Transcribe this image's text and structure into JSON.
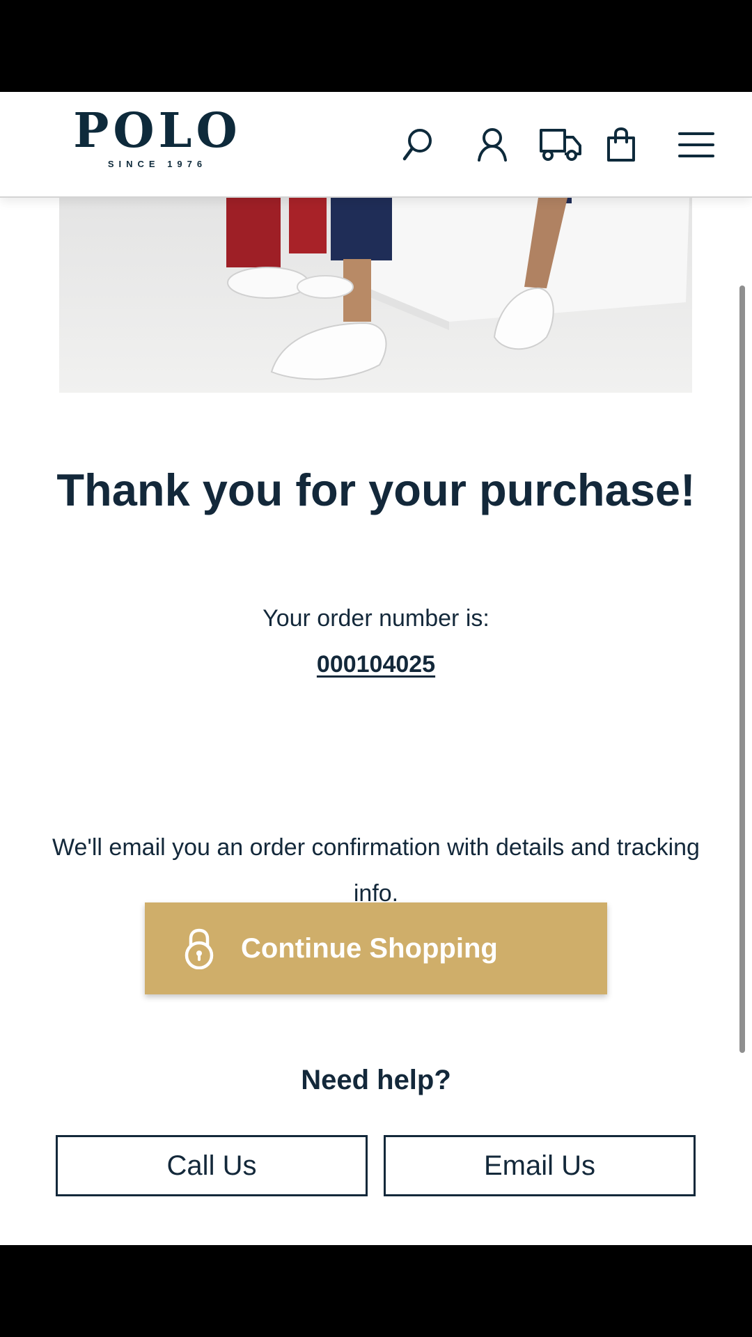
{
  "header": {
    "logo_name": "POLO",
    "logo_tagline": "SINCE 1976",
    "icons": [
      "search-icon",
      "account-icon",
      "delivery-truck-icon",
      "shopping-bag-icon",
      "menu-icon"
    ]
  },
  "confirmation": {
    "title": "Thank you for your purchase!",
    "order_label": "Your order number is:",
    "order_number": "000104025",
    "email_message": "We'll email you an order confirmation with details and tracking info."
  },
  "actions": {
    "continue_label": "Continue Shopping",
    "continue_icon": "lock-icon"
  },
  "help": {
    "title": "Need help?",
    "call_label": "Call Us",
    "email_label": "Email Us"
  },
  "colors": {
    "brand_navy": "#13283a",
    "accent_gold": "#cfae6a",
    "header_border": "#d4d4d4"
  }
}
